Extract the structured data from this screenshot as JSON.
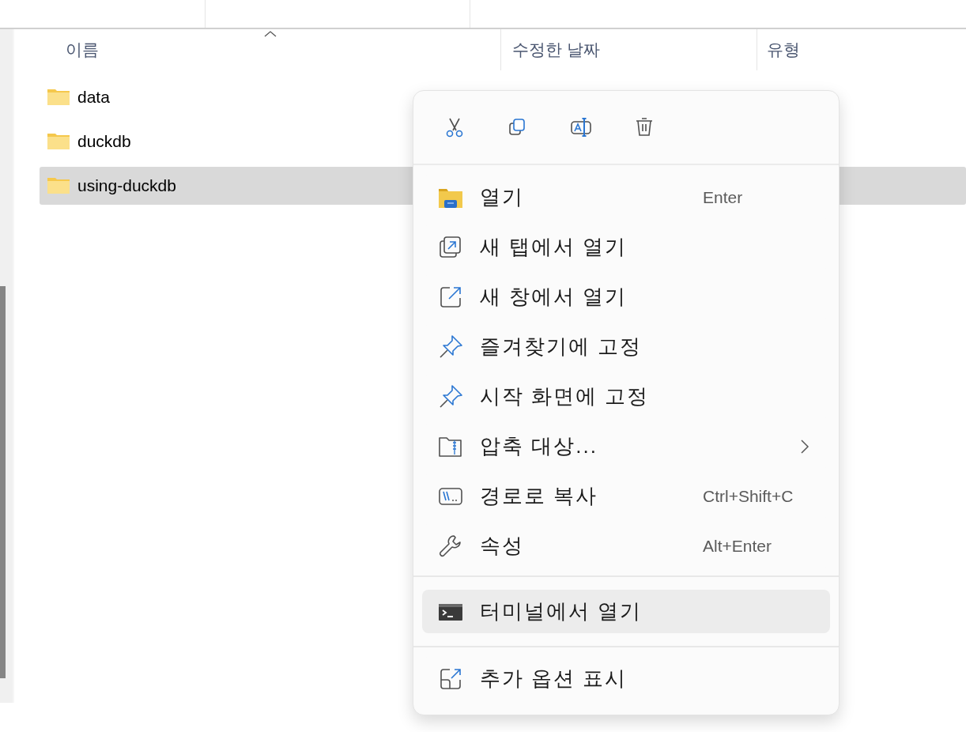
{
  "columns": [
    {
      "label": "이름",
      "sorted": true
    },
    {
      "label": "수정한 날짜",
      "sorted": false
    },
    {
      "label": "유형",
      "sorted": false
    }
  ],
  "rows": [
    {
      "name": "data",
      "selected": false
    },
    {
      "name": "duckdb",
      "selected": false
    },
    {
      "name": "using-duckdb",
      "selected": true
    }
  ],
  "context_menu": {
    "quick_actions": [
      {
        "kind": "cut"
      },
      {
        "kind": "copy"
      },
      {
        "kind": "rename"
      },
      {
        "kind": "delete"
      }
    ],
    "groups": [
      [
        {
          "kind": "open",
          "label": "열기",
          "shortcut": "Enter",
          "submenu": false,
          "highlighted": false
        },
        {
          "kind": "new-tab",
          "label": "새 탭에서 열기",
          "submenu": false,
          "highlighted": false
        },
        {
          "kind": "new-window",
          "label": "새 창에서 열기",
          "submenu": false,
          "highlighted": false
        },
        {
          "kind": "pin",
          "label": "즐겨찾기에 고정",
          "submenu": false,
          "highlighted": false
        },
        {
          "kind": "pin",
          "label": "시작 화면에 고정",
          "submenu": false,
          "highlighted": false
        },
        {
          "kind": "zip",
          "label": "압축 대상...",
          "submenu": true,
          "highlighted": false
        },
        {
          "kind": "path",
          "label": "경로로 복사",
          "shortcut": "Ctrl+Shift+C",
          "submenu": false,
          "highlighted": false
        },
        {
          "kind": "properties",
          "label": "속성",
          "shortcut": "Alt+Enter",
          "submenu": false,
          "highlighted": false
        }
      ],
      [
        {
          "kind": "terminal",
          "label": "터미널에서 열기",
          "submenu": false,
          "highlighted": true
        }
      ],
      [
        {
          "kind": "more",
          "label": "추가 옵션 표시",
          "submenu": false,
          "highlighted": false
        }
      ]
    ]
  }
}
